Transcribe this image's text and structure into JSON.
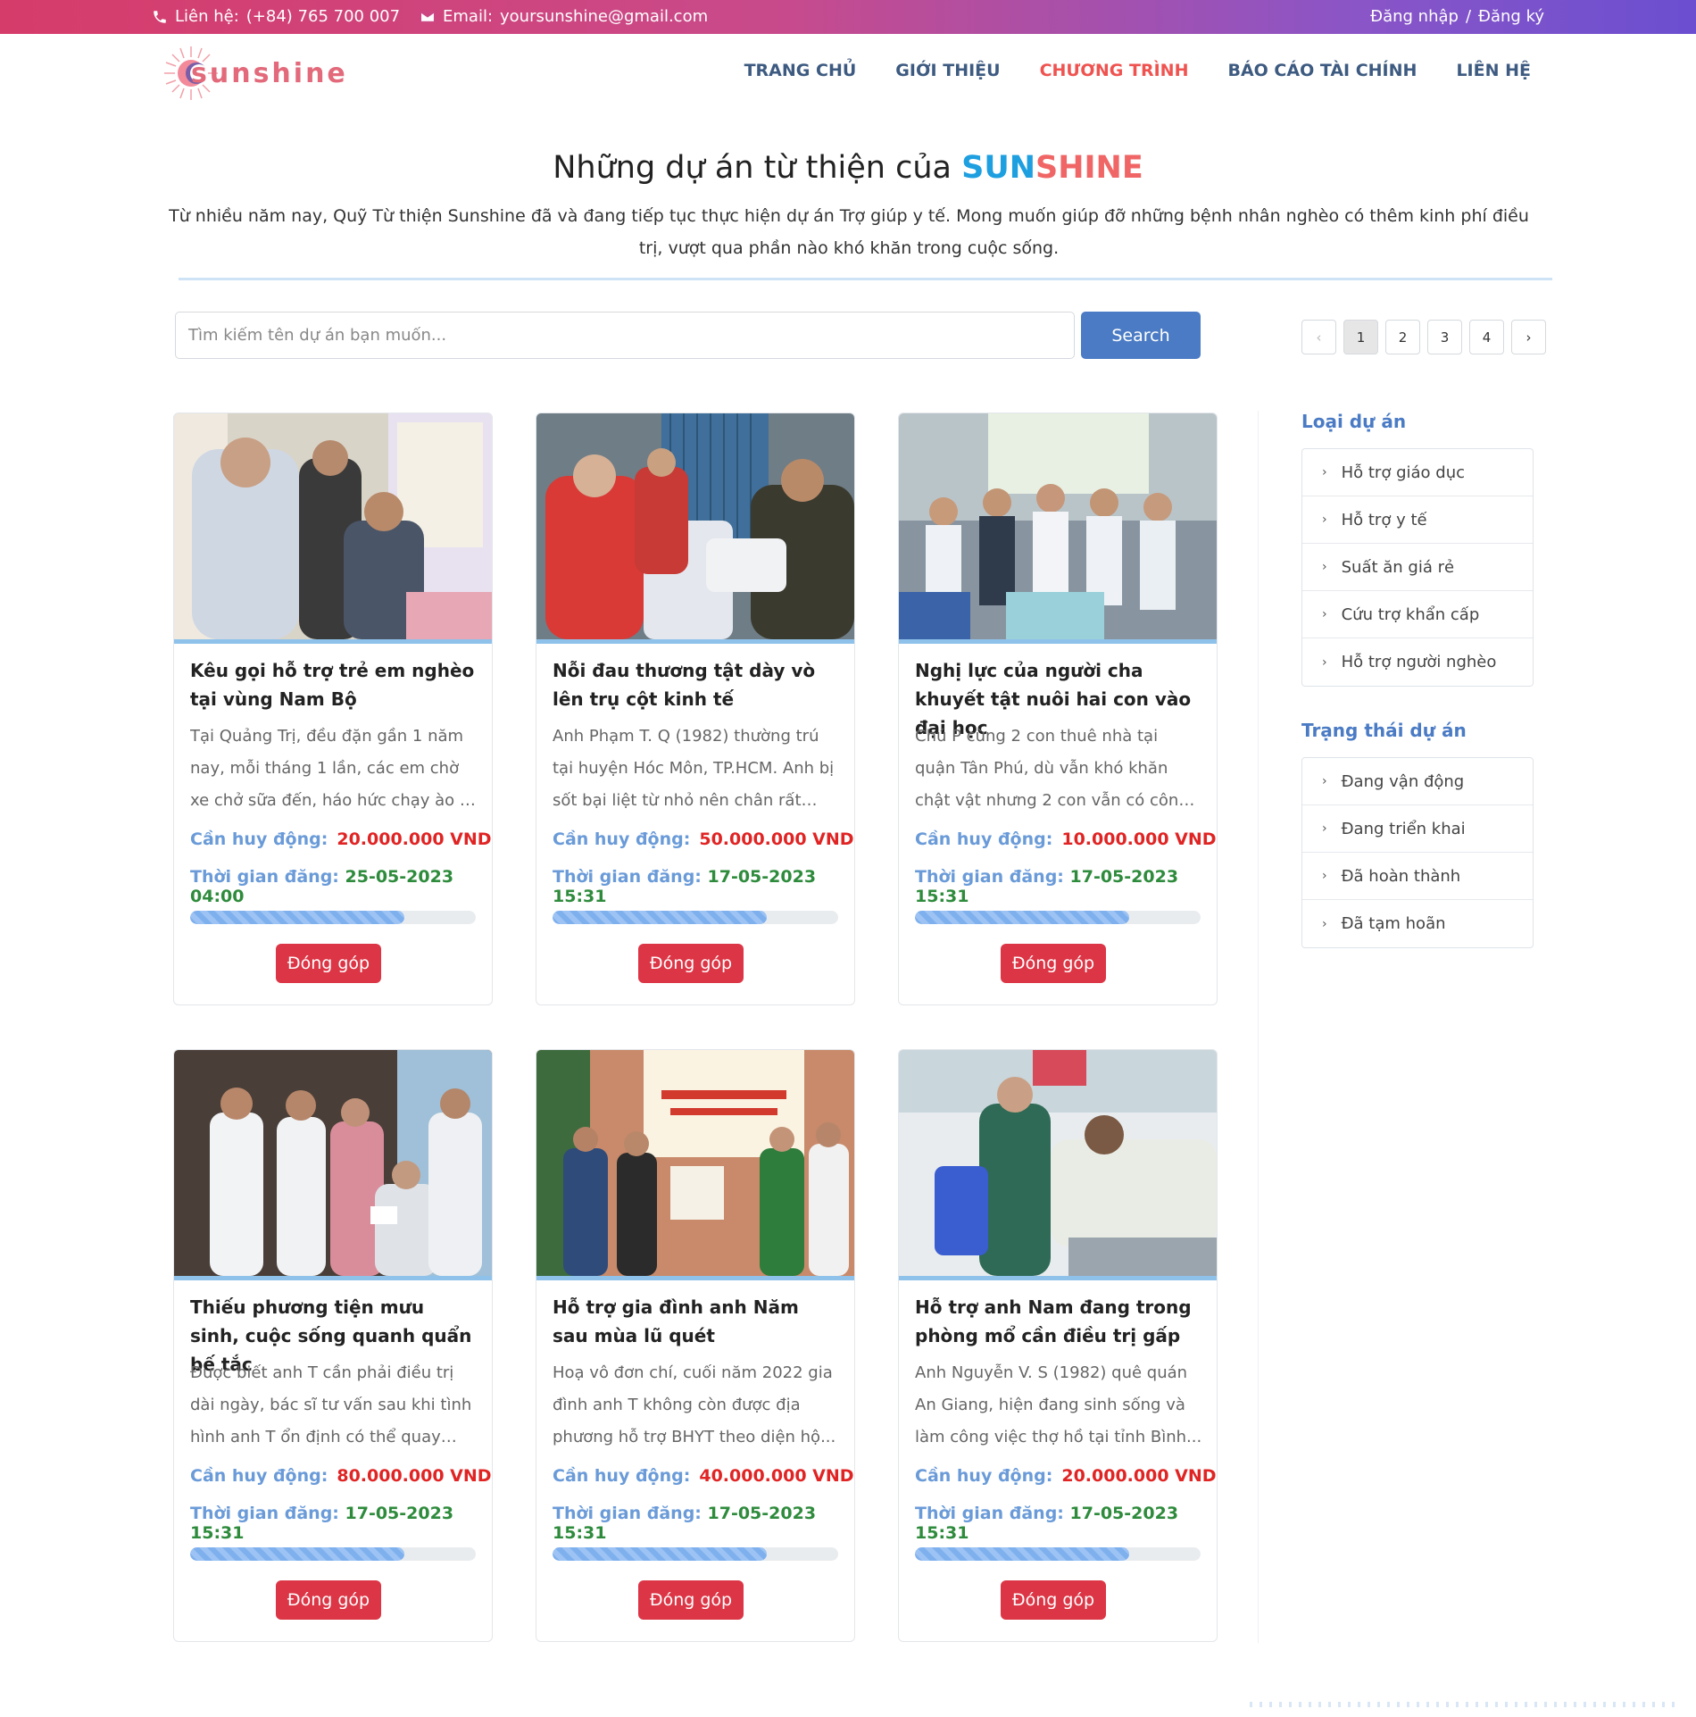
{
  "topbar": {
    "phone_label": "Liên hệ:",
    "phone": "(+84) 765 700 007",
    "email_label": "Email:",
    "email": "yoursunshine@gmail.com",
    "login": "Đăng nhập",
    "sep": "/",
    "register": "Đăng ký"
  },
  "logo": {
    "text": "sunshine"
  },
  "nav": {
    "items": [
      {
        "label": "TRANG CHỦ"
      },
      {
        "label": "GIỚI THIỆU"
      },
      {
        "label": "CHƯƠNG TRÌNH"
      },
      {
        "label": "BÁO CÁO TÀI CHÍNH"
      },
      {
        "label": "LIÊN HỆ"
      }
    ],
    "active": "CHƯƠNG TRÌNH"
  },
  "hero": {
    "title_prefix": "Những dự án từ thiện của",
    "brand_part1": "SUN",
    "brand_part2": "SHINE",
    "description": "Từ nhiều năm nay, Quỹ Từ thiện Sunshine đã và đang tiếp tục thực hiện dự án Trợ giúp y tế. Mong muốn giúp đỡ những bệnh nhân nghèo có thêm kinh phí điều trị, vượt qua phần nào khó khăn trong cuộc sống."
  },
  "search": {
    "placeholder": "Tìm kiếm tên dự án bạn muốn...",
    "button": "Search"
  },
  "pagination": {
    "prev": "‹",
    "pages": [
      "1",
      "2",
      "3",
      "4"
    ],
    "current": "1",
    "next": "›"
  },
  "labels": {
    "need": "Cần huy động:",
    "date": "Thời gian đăng:",
    "donate": "Đóng góp"
  },
  "projects": [
    {
      "title": "Kêu gọi hỗ trợ trẻ em nghèo tại vùng Nam Bộ",
      "desc": "Tại Quảng Trị, đều đặn gần 1 năm nay, mỗi tháng 1 lần, các em chờ xe chở sữa đến, háo hức chạy ào ra đón...",
      "need": "20.000.000 VND",
      "date": "25-05-2023 04:00",
      "progress": 0.75
    },
    {
      "title": "Nỗi đau thương tật dày vò lên trụ cột kinh tế",
      "desc": "Anh Phạm T. Q (1982) thường trú tại huyện Hóc Môn, TP.HCM. Anh bị sốt bại liệt từ nhỏ nên chân rất yếu...",
      "need": "50.000.000 VND",
      "date": "17-05-2023 15:31",
      "progress": 0.75
    },
    {
      "title": "Nghị lực của người cha khuyết tật nuôi hai con vào đại học",
      "desc": "Chú P cùng 2 con thuê nhà tại quận Tân Phú, dù vẫn khó khăn chật vật nhưng 2 con vẫn có công ăn...",
      "need": "10.000.000 VND",
      "date": "17-05-2023 15:31",
      "progress": 0.75
    },
    {
      "title": "Thiếu phương tiện mưu sinh, cuộc sống quanh quẩn bế tắc",
      "desc": "Được biết anh T cần phải điều trị dài ngày, bác sĩ tư vấn sau khi tình hình anh T ổn định có thể quay về...",
      "need": "80.000.000 VND",
      "date": "17-05-2023 15:31",
      "progress": 0.75
    },
    {
      "title": "Hỗ trợ gia đình anh Năm sau mùa lũ quét",
      "desc": "Hoạ vô đơn chí, cuối năm 2022 gia đình anh T không còn được địa phương hỗ trợ BHYT theo diện hộ...",
      "need": "40.000.000 VND",
      "date": "17-05-2023 15:31",
      "progress": 0.75
    },
    {
      "title": "Hỗ trợ anh Nam đang trong phòng mổ cần điều trị gấp",
      "desc": "Anh Nguyễn V. S (1982) quê quán An Giang, hiện đang sinh sống và làm công việc thợ hồ tại tỉnh Bình...",
      "need": "20.000.000 VND",
      "date": "17-05-2023 15:31",
      "progress": 0.75
    }
  ],
  "sidebar": {
    "type_heading": "Loại dự án",
    "types": [
      "Hỗ trợ giáo dục",
      "Hỗ trợ y tế",
      "Suất ăn giá rẻ",
      "Cứu trợ khẩn cấp",
      "Hỗ trợ người nghèo"
    ],
    "status_heading": "Trạng thái dự án",
    "statuses": [
      "Đang vận động",
      "Đang triển khai",
      "Đã hoàn thành",
      "Đã tạm hoãn"
    ]
  },
  "colors": {
    "brand_blue": "#1e9fe0",
    "brand_red": "#f06666",
    "accent": "#4a7bc4",
    "danger": "#dc3545",
    "date_green": "#2e8b3c"
  }
}
